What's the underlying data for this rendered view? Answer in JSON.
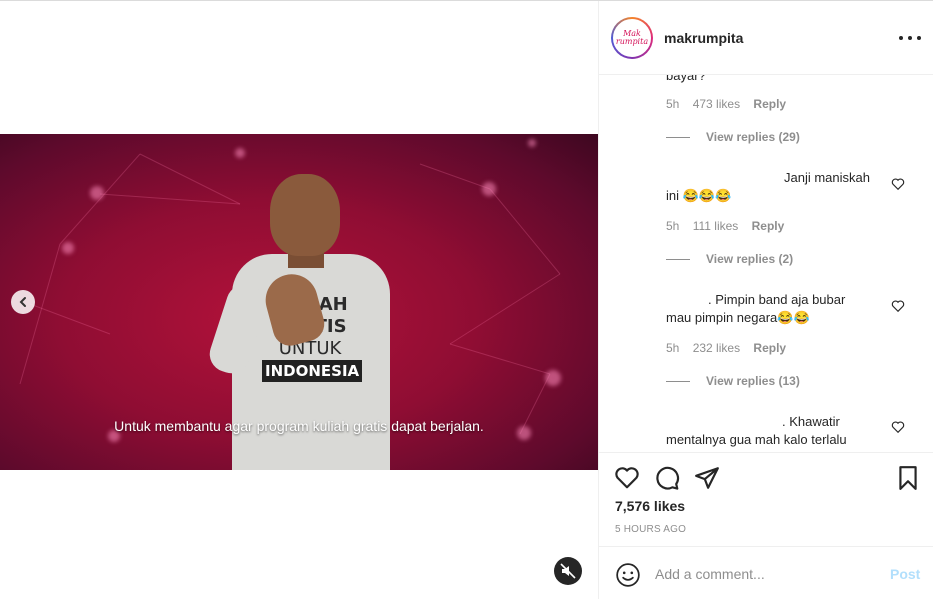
{
  "post": {
    "username": "makrumpita",
    "avatar_text": "Mak rumpita",
    "subtitle": "Untuk membantu agar program kuliah gratis dapat berjalan.",
    "shirt": {
      "line1": "KULIAH",
      "line2": "GRATIS",
      "line3": "UNTUK",
      "line4": "INDONESIA"
    },
    "likes": "7,576 likes",
    "time": "5 HOURS AGO"
  },
  "comments": [
    {
      "text": "bayar?",
      "time": "5h",
      "likes": "473 likes",
      "reply": "Reply",
      "view_replies": "View replies (29)"
    },
    {
      "text_line1": "Janji maniskah",
      "text_line2": "ini 😂😂😂",
      "time": "5h",
      "likes": "111 likes",
      "reply": "Reply",
      "view_replies": "View replies (2)"
    },
    {
      "text_line1": ". Pimpin band aja bubar",
      "text_line2": "mau pimpin negara😂😂",
      "time": "5h",
      "likes": "232 likes",
      "reply": "Reply",
      "view_replies": "View replies (13)"
    },
    {
      "text_line1": ". Khawatir",
      "text_line2": "mentalnya gua mah kalo terlalu"
    }
  ],
  "add_comment": {
    "placeholder": "Add a comment...",
    "post_label": "Post"
  },
  "icons": {
    "carousel_prev": "chevron-left-icon",
    "mute": "muted-speaker-icon",
    "more": "more-options-icon",
    "like": "heart-icon",
    "comment": "comment-icon",
    "share": "paper-plane-icon",
    "save": "bookmark-icon",
    "emoji": "smiley-icon"
  },
  "colors": {
    "video_bg": "#9e0f35",
    "post_button": "#b2dffc",
    "meta_text": "#8e8e8e"
  }
}
